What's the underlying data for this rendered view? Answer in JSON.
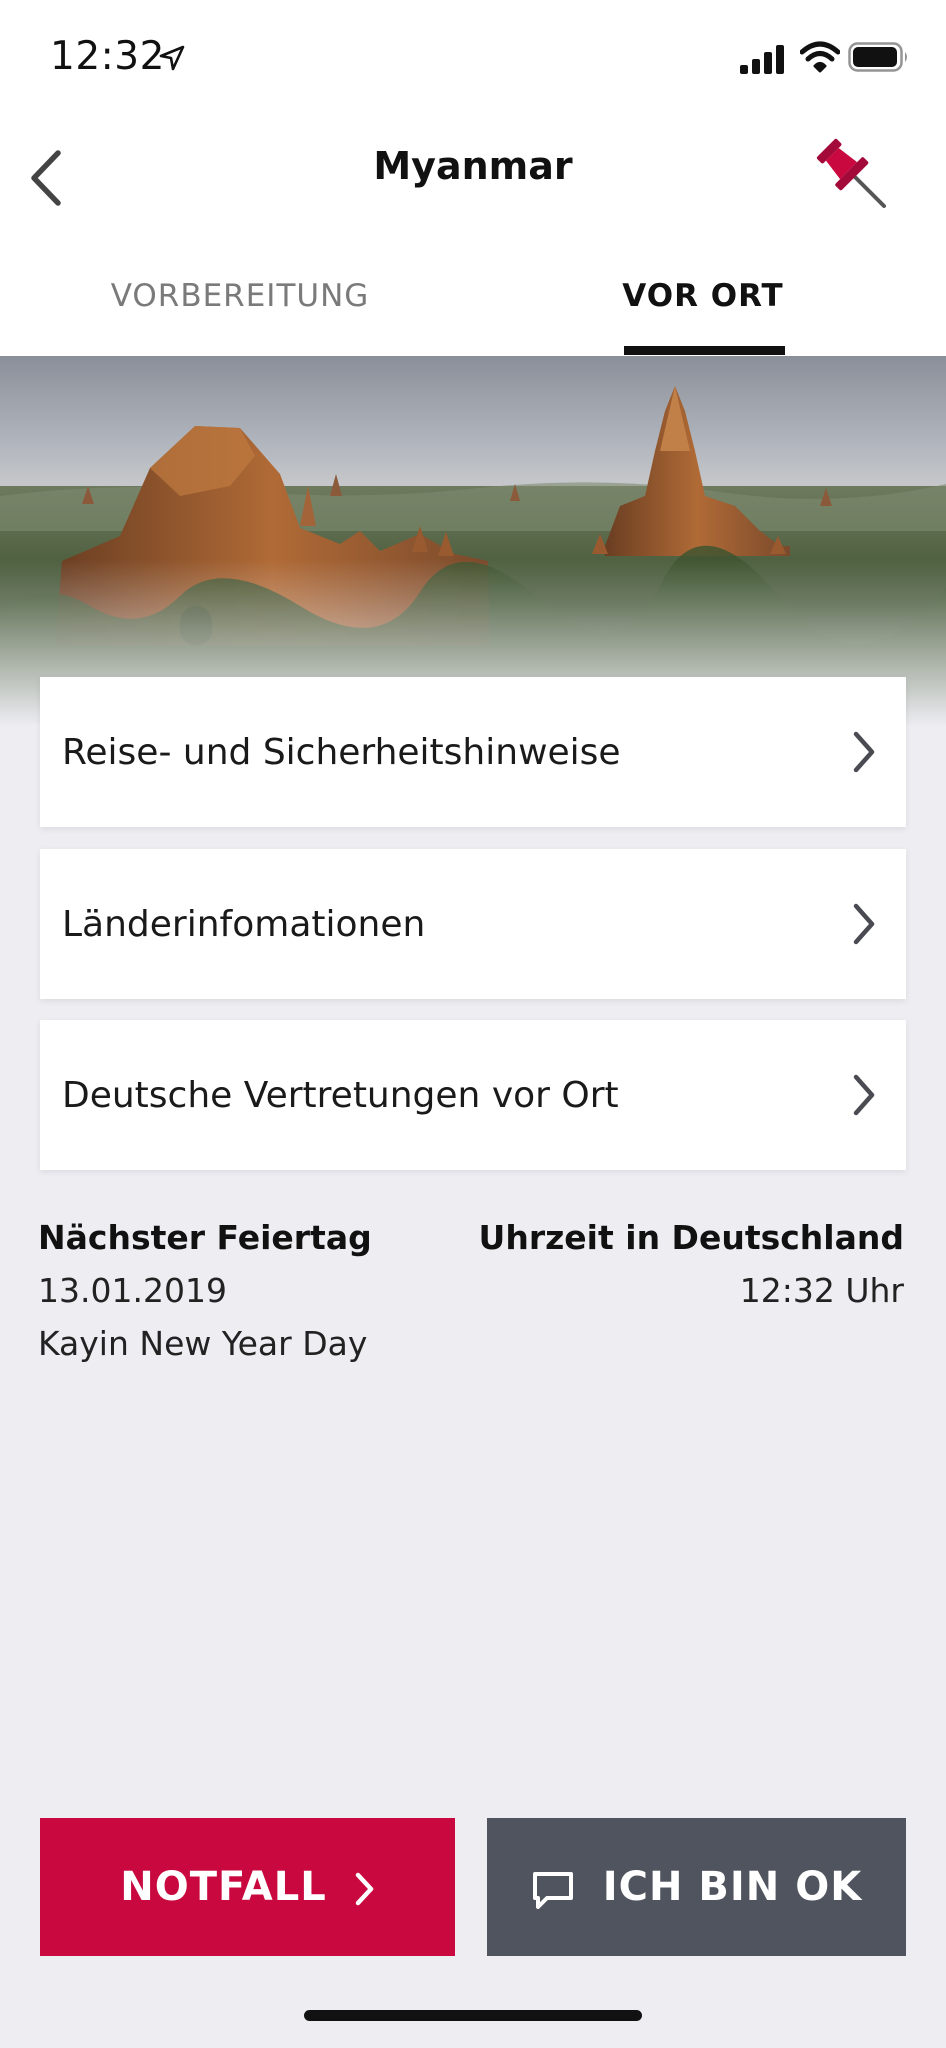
{
  "status_bar": {
    "time": "12:32"
  },
  "nav": {
    "title": "Myanmar"
  },
  "tabs": [
    {
      "label": "VORBEREITUNG",
      "active": false
    },
    {
      "label": "VOR ORT",
      "active": true
    }
  ],
  "menu": [
    {
      "label": "Reise- und Sicherheitshinweise"
    },
    {
      "label": "Länderinfomationen"
    },
    {
      "label": "Deutsche Vertretungen vor Ort"
    }
  ],
  "holiday": {
    "heading": "Nächster Feiertag",
    "date": "13.01.2019",
    "name": "Kayin New Year Day"
  },
  "germany_time": {
    "heading": "Uhrzeit in Deutschland",
    "value": "12:32 Uhr"
  },
  "actions": {
    "emergency_label": "NOTFALL",
    "ok_label": "ICH BIN OK"
  },
  "colors": {
    "accent": "#c8083e",
    "secondary_button": "#50545f",
    "background": "#ededf2"
  },
  "icons": {
    "back": "chevron-left-icon",
    "pin": "pushpin-icon",
    "row_chevron": "chevron-right-icon",
    "message": "message-icon"
  }
}
